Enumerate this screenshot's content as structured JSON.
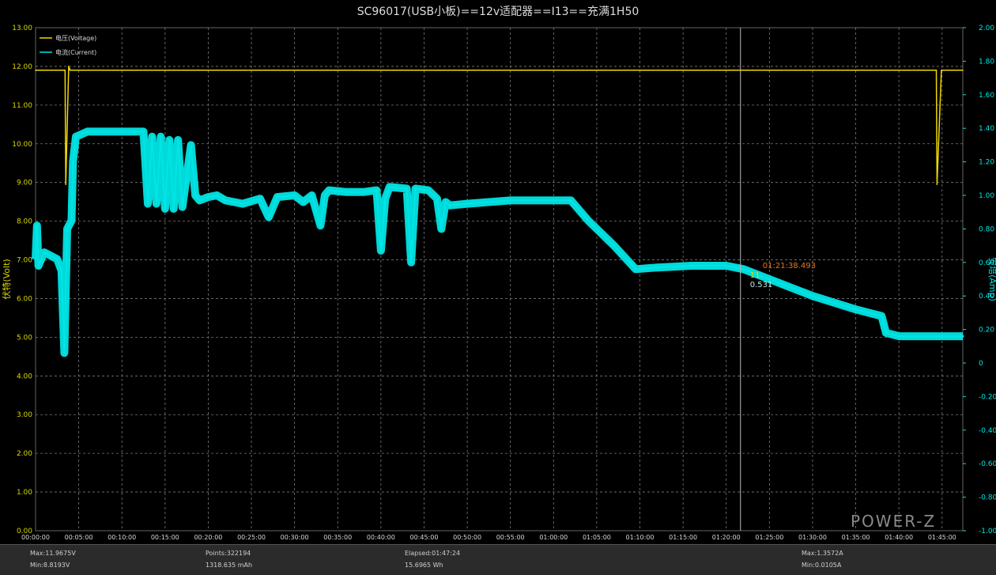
{
  "chart_data": {
    "type": "line",
    "title": "SC96017(USB小板)==12v适配器==I13==充满1H50",
    "xlabel": "",
    "y_left_label": "伏特(Volt)",
    "y_right_label": "安培(Amp)",
    "y_left_lim": [
      0,
      13
    ],
    "y_right_lim": [
      -1.0,
      2.0
    ],
    "x_unit": "hh:mm:ss",
    "x_lim": [
      "00:00:00",
      "01:47:24"
    ],
    "grid": true,
    "legend_position": "top-left",
    "y_left_ticks": [
      "0.00",
      "1.00",
      "2.00",
      "3.00",
      "4.00",
      "5.00",
      "6.00",
      "7.00",
      "8.00",
      "9.00",
      "10.00",
      "11.00",
      "12.00",
      "13.00"
    ],
    "y_right_ticks": [
      "-1.00",
      "-0.80",
      "-0.60",
      "-0.40",
      "-0.20",
      "0",
      "0.20",
      "0.40",
      "0.60",
      "0.80",
      "1.00",
      "1.20",
      "1.40",
      "1.60",
      "1.80",
      "2.00"
    ],
    "x_ticks": [
      "00:00:00",
      "00:05:00",
      "00:10:00",
      "00:15:00",
      "00:20:00",
      "00:25:00",
      "00:30:00",
      "00:35:00",
      "00:40:00",
      "00:45:00",
      "00:50:00",
      "00:55:00",
      "01:00:00",
      "01:05:00",
      "01:10:00",
      "01:15:00",
      "01:20:00",
      "01:25:00",
      "01:30:00",
      "01:35:00",
      "01:40:00",
      "01:45:00"
    ],
    "cursor": {
      "x": "01:21:39",
      "time_label": "01:21:38.493",
      "voltage_label": "11.",
      "current_label": "0.531"
    },
    "series": [
      {
        "name": "电压(Voltage)",
        "axis": "left",
        "color": "#f0d800",
        "points": [
          [
            "00:00:00",
            11.9
          ],
          [
            "00:03:25",
            11.9
          ],
          [
            "00:03:30",
            8.95
          ],
          [
            "00:03:50",
            12.0
          ],
          [
            "00:04:00",
            11.9
          ],
          [
            "01:40:00",
            11.9
          ],
          [
            "01:44:20",
            11.9
          ],
          [
            "01:44:25",
            8.95
          ],
          [
            "01:44:55",
            11.9
          ],
          [
            "01:47:24",
            11.9
          ]
        ]
      },
      {
        "name": "电流(Current)",
        "axis": "right",
        "color": "#00e5e5",
        "points": [
          [
            "00:00:00",
            0.62
          ],
          [
            "00:00:10",
            0.82
          ],
          [
            "00:00:20",
            0.58
          ],
          [
            "00:01:00",
            0.66
          ],
          [
            "00:02:30",
            0.62
          ],
          [
            "00:03:00",
            0.55
          ],
          [
            "00:03:20",
            0.06
          ],
          [
            "00:03:40",
            0.8
          ],
          [
            "00:04:10",
            0.85
          ],
          [
            "00:04:20",
            1.2
          ],
          [
            "00:04:40",
            1.35
          ],
          [
            "00:06:00",
            1.38
          ],
          [
            "00:10:00",
            1.38
          ],
          [
            "00:12:30",
            1.38
          ],
          [
            "00:13:00",
            0.95
          ],
          [
            "00:13:30",
            1.35
          ],
          [
            "00:14:00",
            0.95
          ],
          [
            "00:14:30",
            1.35
          ],
          [
            "00:15:00",
            0.92
          ],
          [
            "00:15:30",
            1.33
          ],
          [
            "00:16:00",
            0.92
          ],
          [
            "00:16:30",
            1.33
          ],
          [
            "00:17:00",
            0.93
          ],
          [
            "00:18:00",
            1.3
          ],
          [
            "00:18:30",
            1.0
          ],
          [
            "00:19:00",
            0.97
          ],
          [
            "00:20:00",
            0.99
          ],
          [
            "00:21:00",
            1.0
          ],
          [
            "00:22:00",
            0.97
          ],
          [
            "00:24:00",
            0.95
          ],
          [
            "00:26:00",
            0.98
          ],
          [
            "00:27:00",
            0.87
          ],
          [
            "00:28:00",
            0.99
          ],
          [
            "00:30:00",
            1.0
          ],
          [
            "00:31:00",
            0.96
          ],
          [
            "00:32:00",
            1.0
          ],
          [
            "00:33:00",
            0.82
          ],
          [
            "00:33:30",
            1.0
          ],
          [
            "00:34:00",
            1.03
          ],
          [
            "00:36:00",
            1.02
          ],
          [
            "00:38:00",
            1.02
          ],
          [
            "00:39:30",
            1.03
          ],
          [
            "00:40:00",
            0.67
          ],
          [
            "00:40:30",
            0.98
          ],
          [
            "00:41:00",
            1.05
          ],
          [
            "00:43:00",
            1.04
          ],
          [
            "00:43:30",
            0.6
          ],
          [
            "00:44:00",
            1.04
          ],
          [
            "00:45:30",
            1.03
          ],
          [
            "00:46:30",
            0.98
          ],
          [
            "00:47:00",
            0.8
          ],
          [
            "00:47:30",
            0.96
          ],
          [
            "00:48:00",
            0.94
          ],
          [
            "00:50:00",
            0.95
          ],
          [
            "00:55:00",
            0.97
          ],
          [
            "01:00:00",
            0.97
          ],
          [
            "01:02:00",
            0.97
          ],
          [
            "01:04:00",
            0.85
          ],
          [
            "01:07:00",
            0.7
          ],
          [
            "01:09:30",
            0.56
          ],
          [
            "01:12:00",
            0.57
          ],
          [
            "01:16:00",
            0.58
          ],
          [
            "01:20:00",
            0.58
          ],
          [
            "01:22:00",
            0.56
          ],
          [
            "01:25:00",
            0.5
          ],
          [
            "01:30:00",
            0.4
          ],
          [
            "01:35:00",
            0.32
          ],
          [
            "01:38:00",
            0.28
          ],
          [
            "01:38:30",
            0.18
          ],
          [
            "01:40:00",
            0.16
          ],
          [
            "01:45:00",
            0.16
          ],
          [
            "01:47:24",
            0.16
          ]
        ]
      }
    ]
  },
  "footer": {
    "max_voltage": "Max:11.9675V",
    "min_voltage": "Min:8.8193V",
    "points": "Points:322194",
    "capacity": "1318.635 mAh",
    "elapsed": "Elapsed:01:47:24",
    "energy": "15.6965 Wh",
    "max_current": "Max:1.3572A",
    "min_current": "Min:0.0105A"
  },
  "logo": "POWER-Z",
  "colors": {
    "voltage": "#f0d800",
    "current": "#00e5e5",
    "grid": "#7a7a7a",
    "axis_text": "#d8d800"
  }
}
